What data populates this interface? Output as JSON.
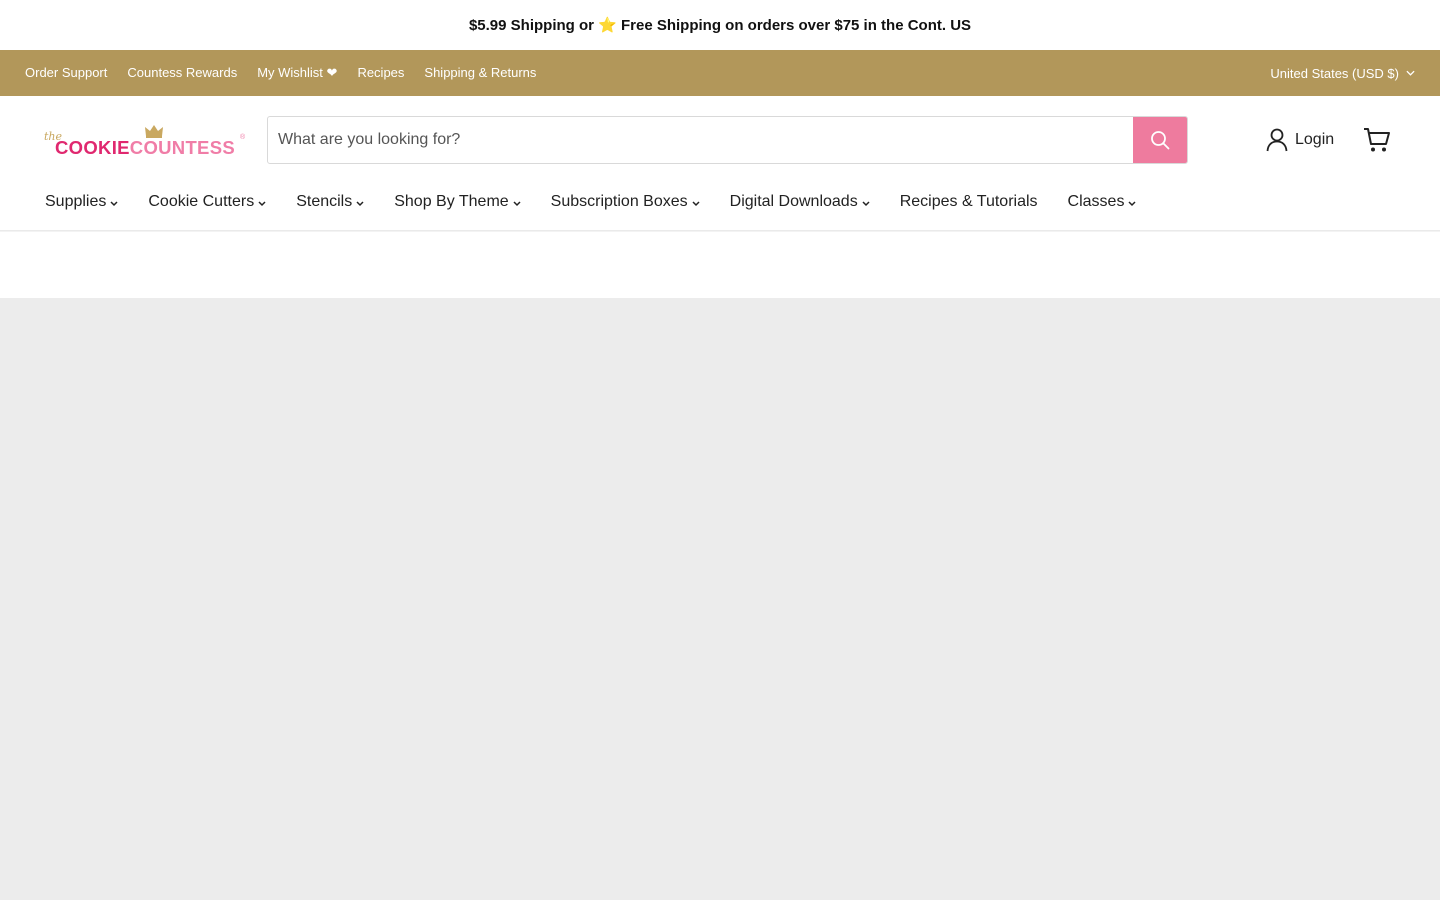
{
  "announcement": {
    "text": "$5.99 Shipping or ⭐ Free Shipping on orders over $75 in the Cont. US"
  },
  "utility_nav": {
    "links": [
      {
        "label": "Order Support"
      },
      {
        "label": "Countess Rewards"
      },
      {
        "label": "My Wishlist ❤"
      },
      {
        "label": "Recipes"
      },
      {
        "label": "Shipping & Returns"
      }
    ],
    "currency": "United States (USD $)"
  },
  "logo": {
    "prefix": "the",
    "word_1": "COOKIE",
    "word_2": "COUNTESS",
    "registered": "®"
  },
  "search": {
    "placeholder": "What are you looking for?",
    "value": ""
  },
  "account": {
    "login_label": "Login"
  },
  "main_nav": {
    "items": [
      {
        "label": "Supplies",
        "dropdown": true
      },
      {
        "label": "Cookie Cutters",
        "dropdown": true
      },
      {
        "label": "Stencils",
        "dropdown": true
      },
      {
        "label": "Shop By Theme",
        "dropdown": true
      },
      {
        "label": "Subscription Boxes",
        "dropdown": true
      },
      {
        "label": "Digital Downloads",
        "dropdown": true
      },
      {
        "label": "Recipes & Tutorials",
        "dropdown": false
      },
      {
        "label": "Classes",
        "dropdown": true
      }
    ]
  },
  "colors": {
    "utility_bar": "#b2975a",
    "search_button": "#ee7b9e",
    "brand_pink_dark": "#e0286f",
    "brand_pink_light": "#f07da7",
    "brand_gold": "#c9a860",
    "page_background": "#ececec"
  },
  "icons": [
    "star-icon",
    "heart-icon",
    "chevron-down-icon",
    "search-icon",
    "user-icon",
    "cart-icon",
    "crown-icon"
  ]
}
